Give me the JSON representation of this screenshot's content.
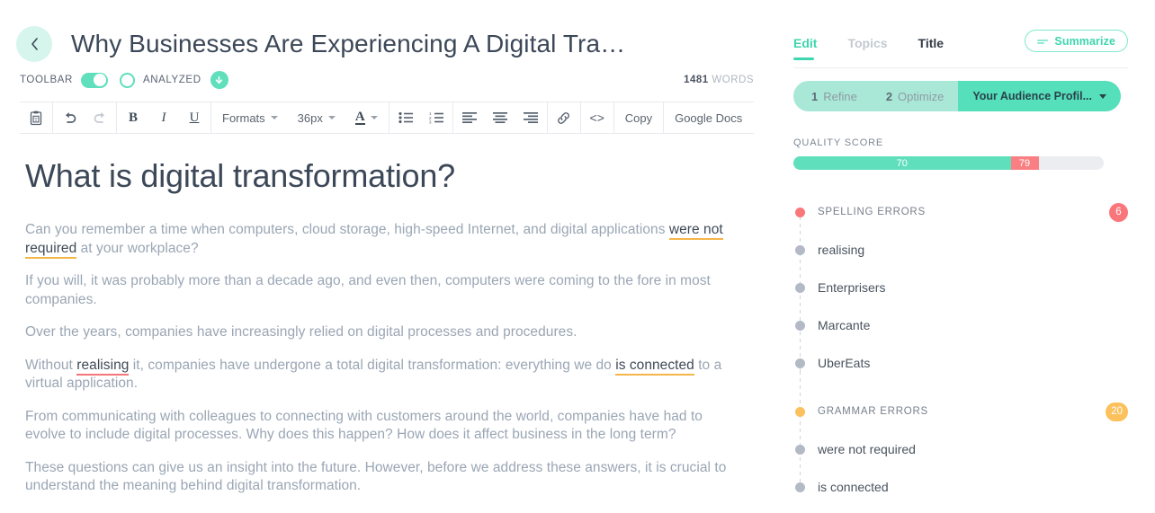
{
  "header": {
    "back_icon": "chevron-left-icon",
    "title": "Why Businesses Are Experiencing A Digital Tra…"
  },
  "status_bar": {
    "toolbar_label": "TOOLBAR",
    "toolbar_toggle_state": "on",
    "analyzed_circle_state": "off",
    "analyzed_label": "ANALYZED",
    "download_icon": "arrow-down-circle-icon",
    "word_count_number": "1481",
    "word_count_label": "WORDS"
  },
  "format_toolbar": {
    "paste_icon": "paste-text-icon",
    "undo_icon": "undo-arrow-icon",
    "redo_icon": "redo-arrow-icon",
    "bold_label": "B",
    "italic_label": "I",
    "underline_label": "U",
    "formats_label": "Formats",
    "font_size_label": "36px",
    "text_color_label": "A",
    "bullet_list_icon": "bullet-list-icon",
    "numbered_list_icon": "numbered-list-icon",
    "align_left_icon": "align-left-icon",
    "align_center_icon": "align-center-icon",
    "align_right_icon": "align-right-icon",
    "link_icon": "link-icon",
    "code_label": "<>",
    "copy_label": "Copy",
    "google_docs_label": "Google Docs"
  },
  "document": {
    "heading": "What is digital transformation?",
    "paragraph_1_a": "Can you remember a time when computers, cloud storage, high-speed Internet, and digital applications ",
    "paragraph_1_err": "were not required",
    "paragraph_1_b": " at your workplace?",
    "paragraph_2": "If you will, it was probably more than a decade ago, and even then, computers were coming to the fore in most companies.",
    "paragraph_3": "Over the years, companies have increasingly relied on digital processes and procedures.",
    "paragraph_4_a": "Without ",
    "paragraph_4_err1": "realising",
    "paragraph_4_b": " it, companies have undergone a total digital transformation: everything we do ",
    "paragraph_4_err2": "is connected",
    "paragraph_4_c": " to a virtual application.",
    "paragraph_5": "From communicating with colleagues to connecting with customers around the world, companies have had to evolve to include digital processes. Why does this happen? How does it affect business in the long term?",
    "paragraph_6": "These questions can give us an insight into the future. However, before we address these answers, it is crucial to understand the meaning behind digital transformation."
  },
  "sidebar": {
    "tabs": [
      {
        "label": "Edit",
        "state": "active"
      },
      {
        "label": "Topics",
        "state": "muted"
      },
      {
        "label": "Title",
        "state": "dark"
      }
    ],
    "summarize_button": {
      "label": "Summarize",
      "icon": "summarize-lines-icon"
    },
    "segments": [
      {
        "num": "1",
        "label": "Refine"
      },
      {
        "num": "2",
        "label": "Optimize"
      }
    ],
    "audience_profile": {
      "label": "Your Audience Profil...",
      "caret_icon": "chevron-down-icon"
    },
    "quality_score": {
      "label": "QUALITY SCORE",
      "good_value": "70",
      "warn_value": "79",
      "good_percent": 70,
      "warn_percent": 9,
      "good_color": "#5fdfbc",
      "warn_color": "#f97f83",
      "track_color": "#ebedf0"
    },
    "issue_groups": [
      {
        "title": "SPELLING ERRORS",
        "count": "6",
        "color": "#f9767b",
        "items": [
          "realising",
          "Enterprisers",
          "Marcante",
          "UberEats"
        ]
      },
      {
        "title": "GRAMMAR ERRORS",
        "count": "20",
        "color": "#fbc15d",
        "items": [
          "were not required",
          "is connected"
        ]
      }
    ]
  }
}
